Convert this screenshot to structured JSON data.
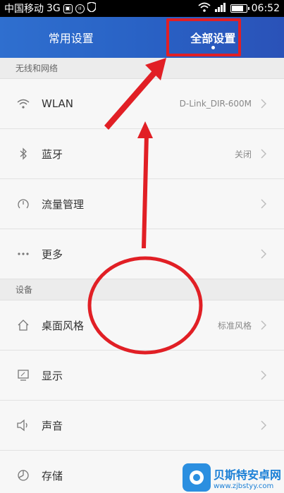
{
  "status_bar": {
    "carrier": "中国移动",
    "network": "3G",
    "time": "06:52",
    "battery_level": 0.85
  },
  "header": {
    "tabs": [
      {
        "label": "常用设置",
        "active": false
      },
      {
        "label": "全部设置",
        "active": true
      }
    ]
  },
  "sections": [
    {
      "title": "无线和网络",
      "items": [
        {
          "icon": "wifi-icon",
          "label": "WLAN",
          "value": "D-Link_DIR-600M"
        },
        {
          "icon": "bluetooth-icon",
          "label": "蓝牙",
          "value": "关闭"
        },
        {
          "icon": "data-usage-icon",
          "label": "流量管理",
          "value": ""
        },
        {
          "icon": "more-icon",
          "label": "更多",
          "value": ""
        }
      ]
    },
    {
      "title": "设备",
      "items": [
        {
          "icon": "home-icon",
          "label": "桌面风格",
          "value": "标准风格"
        },
        {
          "icon": "display-icon",
          "label": "显示",
          "value": ""
        },
        {
          "icon": "speaker-icon",
          "label": "声音",
          "value": ""
        },
        {
          "icon": "storage-icon",
          "label": "存储",
          "value": ""
        }
      ]
    }
  ],
  "watermark": {
    "title": "贝斯特安卓网",
    "url": "www.zjbstyy.com"
  },
  "colors": {
    "header_blue": "#2962c5",
    "annotation_red": "#e11f25"
  }
}
